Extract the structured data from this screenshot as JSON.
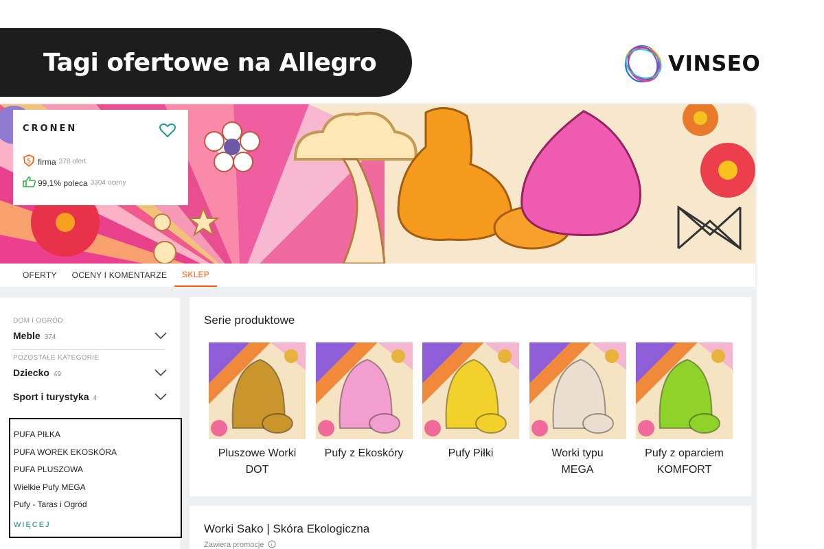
{
  "header": {
    "title": "Tagi ofertowe na Allegro"
  },
  "logo": {
    "text": "VINSEO"
  },
  "seller": {
    "name": "CRONEN",
    "type_label": "firma",
    "offers": "378 ofert",
    "recommend": "99,1% poleca",
    "ratings": "3304 oceny"
  },
  "tabs": [
    {
      "label": "OFERTY"
    },
    {
      "label": "OCENY I KOMENTARZE"
    },
    {
      "label": "SKLEP",
      "active": true
    }
  ],
  "sidebar": {
    "section1": "DOM I OGRÓD",
    "cat1": {
      "name": "Meble",
      "count": "374"
    },
    "section2": "POZOSTAŁE KATEGORIE",
    "cat2": {
      "name": "Dziecko",
      "count": "49"
    },
    "cat3": {
      "name": "Sport i turystyka",
      "count": "4"
    },
    "tags": [
      "PUFA PIŁKA",
      "PUFA WOREK EKOSKÓRA",
      "PUFA PLUSZOWA",
      "Wielkie Pufy MEGA",
      "Pufy - Taras i Ogród"
    ],
    "more": "WIĘCEJ"
  },
  "series": {
    "title": "Serie produktowe",
    "items": [
      {
        "line1": "Pluszowe Worki",
        "line2": "DOT",
        "color": "#c9962e"
      },
      {
        "line1": "Pufy z Ekoskóry",
        "line2": "",
        "color": "#f29fd0"
      },
      {
        "line1": "Pufy Piłki",
        "line2": "",
        "color": "#f2d22a"
      },
      {
        "line1": "Worki typu",
        "line2": "MEGA",
        "color": "#eadfd0"
      },
      {
        "line1": "Pufy z oparciem",
        "line2": "KOMFORT",
        "color": "#8fd32a"
      }
    ]
  },
  "offer": {
    "title": "Worki Sako | Skóra Ekologiczna",
    "promo": "Zawiera promocje"
  },
  "colors": {
    "accent": "#ff5a00",
    "dark": "#1d1d1d",
    "teal": "#1a8a7a"
  }
}
